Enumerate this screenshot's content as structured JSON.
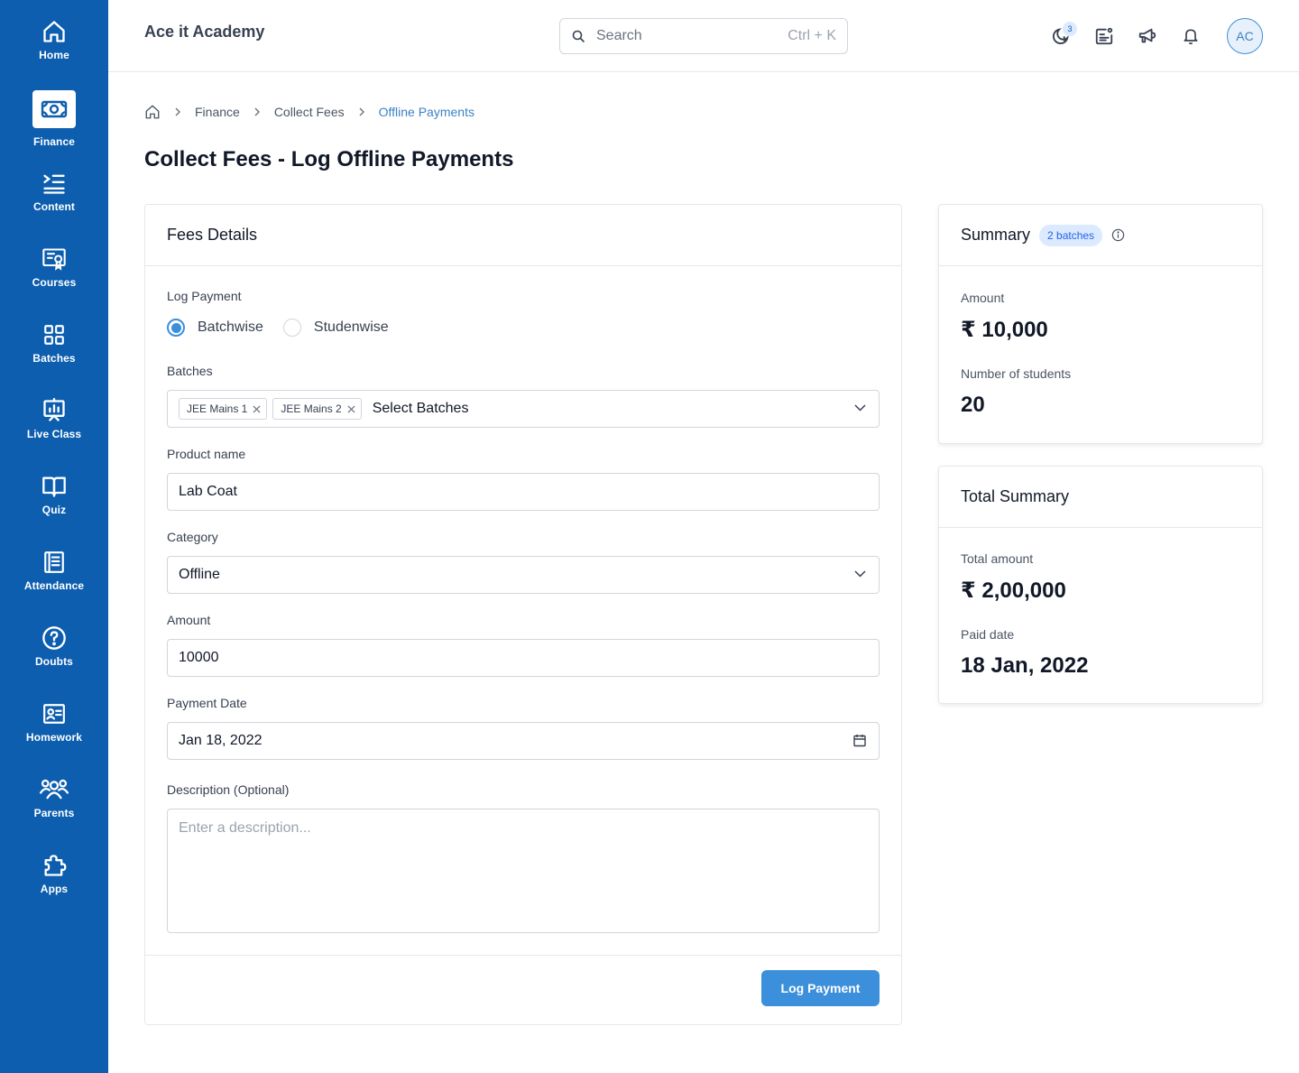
{
  "sidebar": {
    "items": [
      {
        "label": "Home",
        "icon": "home-icon"
      },
      {
        "label": "Finance",
        "icon": "cash-icon",
        "active": true
      },
      {
        "label": "Content",
        "icon": "content-list-icon"
      },
      {
        "label": "Courses",
        "icon": "certificate-icon"
      },
      {
        "label": "Batches",
        "icon": "grid-icon"
      },
      {
        "label": "Live Class",
        "icon": "presentation-icon"
      },
      {
        "label": "Quiz",
        "icon": "book-icon"
      },
      {
        "label": "Attendance",
        "icon": "register-icon"
      },
      {
        "label": "Doubts",
        "icon": "question-icon"
      },
      {
        "label": "Homework",
        "icon": "id-card-icon"
      },
      {
        "label": "Parents",
        "icon": "people-icon"
      },
      {
        "label": "Apps",
        "icon": "puzzle-icon"
      }
    ]
  },
  "header": {
    "title": "Ace it Academy",
    "search_placeholder": "Search",
    "search_shortcut": "Ctrl + K",
    "notification_count": "3",
    "avatar_initials": "AC"
  },
  "breadcrumb": {
    "items": [
      "Finance",
      "Collect Fees"
    ],
    "current": "Offline Payments"
  },
  "page_title": "Collect Fees - Log Offline Payments",
  "form": {
    "heading": "Fees Details",
    "log_payment_label": "Log Payment",
    "options": [
      "Batchwise",
      "Studenwise"
    ],
    "batches_label": "Batches",
    "selected_batches": [
      "JEE Mains 1",
      "JEE Mains 2"
    ],
    "batches_placeholder": "Select Batches",
    "product_label": "Product name",
    "product_value": "Lab Coat",
    "category_label": "Category",
    "category_value": "Offline",
    "amount_label": "Amount",
    "amount_value": "10000",
    "date_label": "Payment Date",
    "date_value": "Jan 18, 2022",
    "description_label": "Description (Optional)",
    "description_placeholder": "Enter a description...",
    "submit_label": "Log Payment"
  },
  "summary": {
    "heading": "Summary",
    "badge": "2 batches",
    "amount_label": "Amount",
    "amount_value": "₹ 10,000",
    "students_label": "Number of students",
    "students_value": "20"
  },
  "total_summary": {
    "heading": "Total Summary",
    "total_label": "Total amount",
    "total_value": "₹ 2,00,000",
    "date_label": "Paid date",
    "date_value": "18 Jan, 2022"
  },
  "colors": {
    "sidebar": "#0d5eaf",
    "accent": "#3b8fdb"
  }
}
